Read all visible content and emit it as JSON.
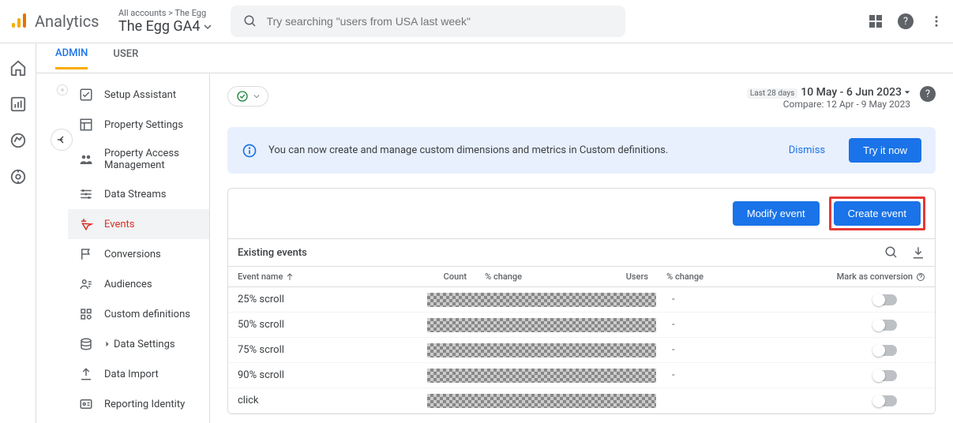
{
  "header": {
    "brand": "Analytics",
    "breadcrumb": "All accounts > The Egg",
    "property": "The Egg GA4",
    "search_placeholder": "Try searching \"users from USA last week\""
  },
  "tabs": {
    "admin": "ADMIN",
    "user": "USER"
  },
  "sidebar": {
    "items": [
      "Setup Assistant",
      "Property Settings",
      "Property Access Management",
      "Data Streams",
      "Events",
      "Conversions",
      "Audiences",
      "Custom definitions",
      "Data Settings",
      "Data Import",
      "Reporting Identity"
    ]
  },
  "date": {
    "badge": "Last 28 days",
    "range": "10 May - 6 Jun 2023",
    "compare": "Compare: 12 Apr - 9 May 2023"
  },
  "banner": {
    "message": "You can now create and manage custom dimensions and metrics in Custom definitions.",
    "dismiss": "Dismiss",
    "cta": "Try it now"
  },
  "actions": {
    "modify": "Modify event",
    "create": "Create event"
  },
  "table": {
    "title": "Existing events",
    "headers": {
      "name": "Event name",
      "count": "Count",
      "chg": "% change",
      "users": "Users",
      "mark": "Mark as conversion"
    },
    "rows": [
      {
        "name": "25% scroll",
        "dash": "-"
      },
      {
        "name": "50% scroll",
        "dash": "-"
      },
      {
        "name": "75% scroll",
        "dash": "-"
      },
      {
        "name": "90% scroll",
        "dash": "-"
      },
      {
        "name": "click",
        "dash": ""
      }
    ]
  }
}
